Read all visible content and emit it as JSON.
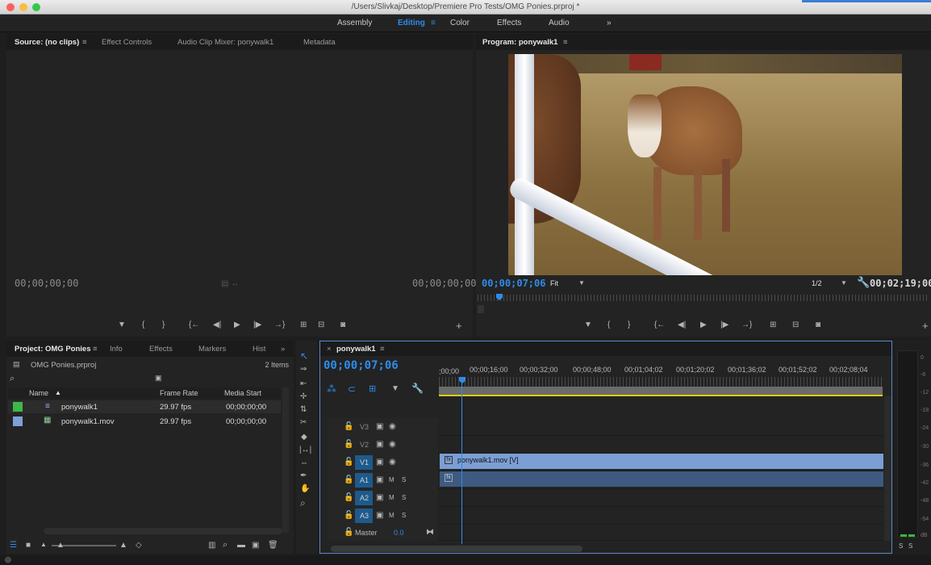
{
  "titlebar": {
    "title": "/Users/Slivkaj/Desktop/Premiere Pro Tests/OMG Ponies.prproj *"
  },
  "workspaces": {
    "items": [
      "Assembly",
      "Editing",
      "Color",
      "Effects",
      "Audio"
    ],
    "menu_glyph": "≡",
    "more": "»"
  },
  "source_panel": {
    "tabs": [
      "Source: (no clips)",
      "Effect Controls",
      "Audio Clip Mixer: ponywalk1",
      "Metadata"
    ],
    "tab_menu": "≡",
    "timecode_left": "00;00;00;00",
    "timecode_right": "00;00;00;00"
  },
  "program_panel": {
    "title": "Program: ponywalk1",
    "tab_menu": "≡",
    "timecode": "00;00;07;06",
    "fit_label": "Fit",
    "resolution": "1/2",
    "duration": "00;02;19;00"
  },
  "project_panel": {
    "tabs": [
      "Project: OMG Ponies",
      "Info",
      "Effects",
      "Markers",
      "Hist"
    ],
    "tab_menu": "≡",
    "more": "»",
    "file_name": "OMG Ponies.prproj",
    "item_count": "2 Items",
    "columns": [
      "Name",
      "Frame Rate",
      "Media Start"
    ],
    "sort_arrow": "▲",
    "rows": [
      {
        "name": "ponywalk1",
        "frame_rate": "29.97 fps",
        "media_start": "00;00;00;00",
        "label_color": "#3cb84a"
      },
      {
        "name": "ponywalk1.mov",
        "frame_rate": "29.97 fps",
        "media_start": "00;00;00;00",
        "label_color": "#7f9fd6"
      }
    ]
  },
  "timeline": {
    "tab": "ponywalk1",
    "close": "×",
    "tab_menu": "≡",
    "timecode": "00;00;07;06",
    "ruler": [
      ";00;00",
      "00;00;16;00",
      "00;00;32;00",
      "00;00;48;00",
      "00;01;04;02",
      "00;01;20;02",
      "00;01;36;02",
      "00;01;52;02",
      "00;02;08;04"
    ],
    "video_tracks": [
      "V3",
      "V2",
      "V1"
    ],
    "audio_tracks": [
      "A1",
      "A2",
      "A3"
    ],
    "master_label": "Master",
    "master_value": "0.0",
    "mute": "M",
    "solo": "S",
    "clip_name": "ponywalk1.mov [V]",
    "fx_badge": "fx"
  },
  "meters": {
    "labels": [
      "0",
      "-6",
      "-12",
      "-18",
      "-24",
      "-30",
      "-36",
      "-42",
      "-48",
      "-54",
      "dB"
    ],
    "solo_left": "S",
    "solo_right": "S"
  },
  "colors": {
    "accent": "#2d8ceb",
    "clip": "#7b9fd4",
    "yellow": "#d8d000"
  }
}
